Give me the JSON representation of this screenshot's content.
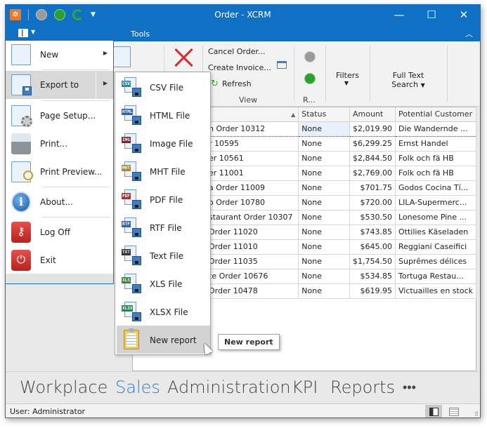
{
  "window": {
    "title": "Order - XCRM",
    "controls": [
      "minimize",
      "maximize",
      "close"
    ]
  },
  "quick_access": {
    "icons": [
      "app-logo-icon",
      "move-up-icon",
      "move-down-icon",
      "refresh-icon",
      "customize-dropdown-icon"
    ]
  },
  "ribbon": {
    "tab_label": "Tools",
    "cancel_order": "Cancel Order...",
    "create_invoice": "Create Invoice...",
    "refresh": "Refresh",
    "view_group": "View",
    "r_group": "R...",
    "filters": "Filters",
    "full_text_search_line1": "Full Text",
    "full_text_search_line2": "Search"
  },
  "app_menu": {
    "items": [
      {
        "label": "New",
        "has_submenu": true
      },
      {
        "label": "Export to",
        "has_submenu": true
      },
      {
        "label": "Page Setup..."
      },
      {
        "label": "Print..."
      },
      {
        "label": "Print Preview..."
      },
      {
        "label": "About..."
      },
      {
        "label": "Log Off"
      },
      {
        "label": "Exit"
      }
    ]
  },
  "export_submenu": {
    "items": [
      {
        "label": "CSV File",
        "tag": "CSV",
        "color": "#1f8fa8"
      },
      {
        "label": "HTML File",
        "tag": "HTML",
        "color": "#2a63b8"
      },
      {
        "label": "Image File",
        "tag": "IMG",
        "color": "#8a1f2a"
      },
      {
        "label": "MHT File",
        "tag": "MHT",
        "color": "#b5881a"
      },
      {
        "label": "PDF File",
        "tag": "PDF",
        "color": "#c2262c"
      },
      {
        "label": "RTF File",
        "tag": "RTF",
        "color": "#2a63b8"
      },
      {
        "label": "Text File",
        "tag": "TXT",
        "color": "#333333"
      },
      {
        "label": "XLS File",
        "tag": "XLS",
        "color": "#2e8b2e"
      },
      {
        "label": "XLSX File",
        "tag": "XLSX",
        "color": "#1e8a5a"
      },
      {
        "label": "New report"
      }
    ],
    "tooltip": "New report"
  },
  "grid": {
    "columns": [
      "",
      "Status",
      "Amount",
      "Potential Customer"
    ],
    "rows": [
      [
        "h Order 10312",
        "None",
        "$2,019.90",
        "Die Wandernde ..."
      ],
      [
        "r 10595",
        "None",
        "$6,299.25",
        "Ernst Handel"
      ],
      [
        "er 10561",
        "None",
        "$2,844.50",
        "Folk och fä HB"
      ],
      [
        "er 11001",
        "None",
        "$2,769.00",
        "Folk och fä HB"
      ],
      [
        "a Order 11009",
        "None",
        "$701.75",
        "Godos Cocina Tí..."
      ],
      [
        "o Order 10780",
        "None",
        "$720.00",
        "LILA-Supermerc..."
      ],
      [
        "staurant Order 10307",
        "None",
        "$530.50",
        "Lonesome Pine ..."
      ],
      [
        "Order 11020",
        "None",
        "$743.85",
        "Ottilies Käseladen"
      ],
      [
        "Order 11010",
        "None",
        "$645.00",
        "Reggiani Caseifici"
      ],
      [
        "Order 11035",
        "None",
        "$1,754.50",
        "Suprêmes délices"
      ],
      [
        "te Order 10676",
        "None",
        "$534.85",
        "Tortuga Restau..."
      ],
      [
        "Order 10478",
        "None",
        "$619.95",
        "Victuailles en stock"
      ]
    ]
  },
  "navigation": {
    "items": [
      "Workplace",
      "Sales",
      "Administration",
      "KPI",
      "Reports",
      "•••"
    ],
    "active": "Sales"
  },
  "status_bar": {
    "user": "User: Administrator"
  },
  "colors": {
    "title_bar": "#1070c4",
    "accent_nav": "#2b7cd3"
  }
}
